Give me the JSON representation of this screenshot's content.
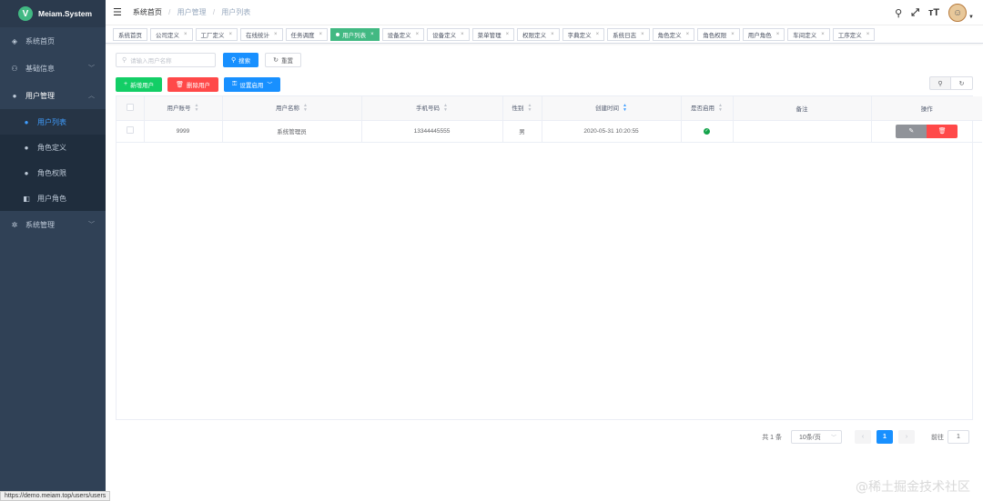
{
  "app": {
    "logo_letter": "V",
    "title": "Meiam.System"
  },
  "sidebar": {
    "items": [
      {
        "label": "系统首页",
        "icon": "dashboard-icon"
      },
      {
        "label": "基础信息",
        "icon": "sitemap-icon"
      },
      {
        "label": "用户管理",
        "icon": "user-icon"
      },
      {
        "label": "系统管理",
        "icon": "gear-icon"
      }
    ],
    "user_sub": [
      {
        "label": "用户列表",
        "icon": "user-list-icon"
      },
      {
        "label": "角色定义",
        "icon": "role-icon"
      },
      {
        "label": "角色权限",
        "icon": "role-permission-icon"
      },
      {
        "label": "用户角色",
        "icon": "user-role-icon"
      }
    ]
  },
  "breadcrumb": {
    "home": "系统首页",
    "group": "用户管理",
    "current": "用户列表"
  },
  "tags": [
    "系统首页",
    "公司定义",
    "工厂定义",
    "在线统计",
    "任务调度",
    "用户列表",
    "设备定义",
    "设备定义",
    "菜单管理",
    "权限定义",
    "字典定义",
    "系统日志",
    "角色定义",
    "角色权限",
    "用户角色",
    "车间定义",
    "工序定义"
  ],
  "search": {
    "placeholder": "请输入用户名称",
    "search_label": "搜索",
    "reset_label": "重置"
  },
  "actions": {
    "add_label": "新增用户",
    "delete_label": "删除用户",
    "enable_label": "设置启用"
  },
  "table": {
    "headers": [
      "用户账号",
      "用户名称",
      "手机号码",
      "性别",
      "创建时间",
      "是否启用",
      "备注",
      "操作"
    ],
    "rows": [
      {
        "account": "9999",
        "name": "系统管理员",
        "phone": "13344445555",
        "sex": "男",
        "created": "2020-05-31 10:20:55",
        "enabled": true,
        "remark": ""
      }
    ]
  },
  "pagination": {
    "total": "共 1 条",
    "page_size": "10条/页",
    "current": "1",
    "goto_label": "前往",
    "goto_value": "1"
  },
  "status_url": "https://demo.meiam.top/users/users",
  "watermark": "@稀土掘金技术社区",
  "colors": {
    "sidebar_bg": "#304156",
    "active_tag": "#42b983",
    "primary": "#1890ff",
    "success": "#13ce66",
    "danger": "#ff4949"
  }
}
